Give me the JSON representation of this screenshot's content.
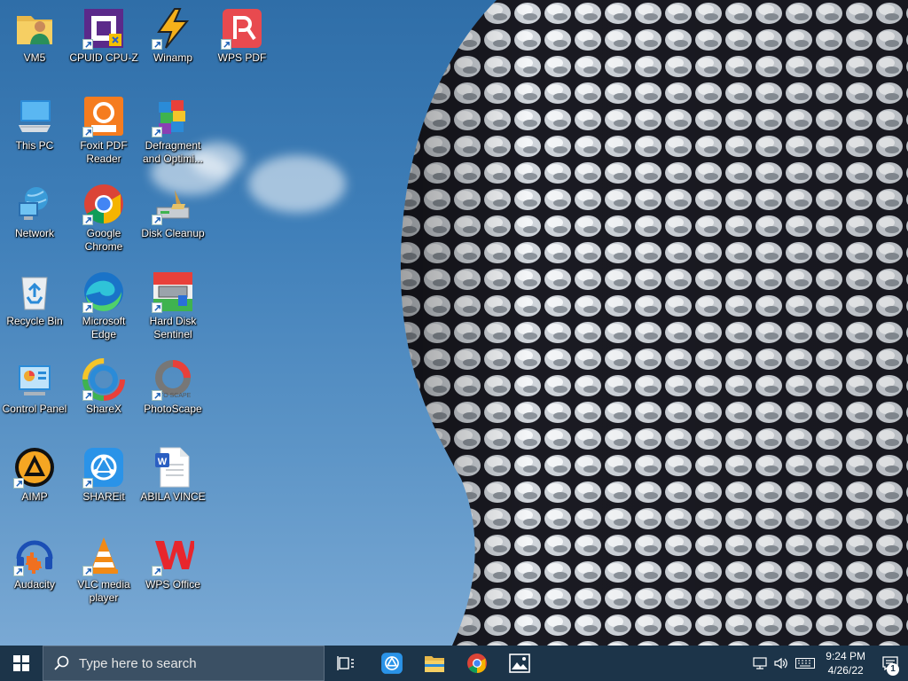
{
  "desktop": {
    "icons": [
      {
        "label": "VM5",
        "icon": "user-folder-icon"
      },
      {
        "label": "CPUID CPU-Z",
        "icon": "cpuz-icon"
      },
      {
        "label": "Winamp",
        "icon": "winamp-icon"
      },
      {
        "label": "WPS PDF",
        "icon": "wps-pdf-icon"
      },
      {
        "label": "This PC",
        "icon": "computer-icon"
      },
      {
        "label": "Foxit PDF Reader",
        "icon": "foxit-icon"
      },
      {
        "label": "Defragment and Optimi...",
        "icon": "defrag-icon"
      },
      {
        "label": "Network",
        "icon": "network-icon"
      },
      {
        "label": "Google Chrome",
        "icon": "chrome-icon"
      },
      {
        "label": "Disk Cleanup",
        "icon": "disk-cleanup-icon"
      },
      {
        "label": "Recycle Bin",
        "icon": "recycle-bin-icon"
      },
      {
        "label": "Microsoft Edge",
        "icon": "edge-icon"
      },
      {
        "label": "Hard Disk Sentinel",
        "icon": "hdsentinel-icon"
      },
      {
        "label": "Control Panel",
        "icon": "control-panel-icon"
      },
      {
        "label": "ShareX",
        "icon": "sharex-icon"
      },
      {
        "label": "PhotoScape",
        "icon": "photoscape-icon"
      },
      {
        "label": "AIMP",
        "icon": "aimp-icon"
      },
      {
        "label": "SHAREit",
        "icon": "shareit-icon"
      },
      {
        "label": "ABILA VINCE",
        "icon": "word-document-icon"
      },
      {
        "label": "Audacity",
        "icon": "audacity-icon"
      },
      {
        "label": "VLC media player",
        "icon": "vlc-icon"
      },
      {
        "label": "WPS Office",
        "icon": "wps-office-icon"
      }
    ]
  },
  "taskbar": {
    "search_placeholder": "Type here to search",
    "pinned": [
      "task-view-icon",
      "shareit-icon",
      "file-explorer-icon",
      "chrome-icon",
      "photos-icon"
    ],
    "clock_time": "9:24 PM",
    "clock_date": "4/26/22",
    "notification_count": "1"
  },
  "colors": {
    "taskbar": "#1c3449",
    "search_box": "#3b5064",
    "sky": "#3f7fb9"
  }
}
